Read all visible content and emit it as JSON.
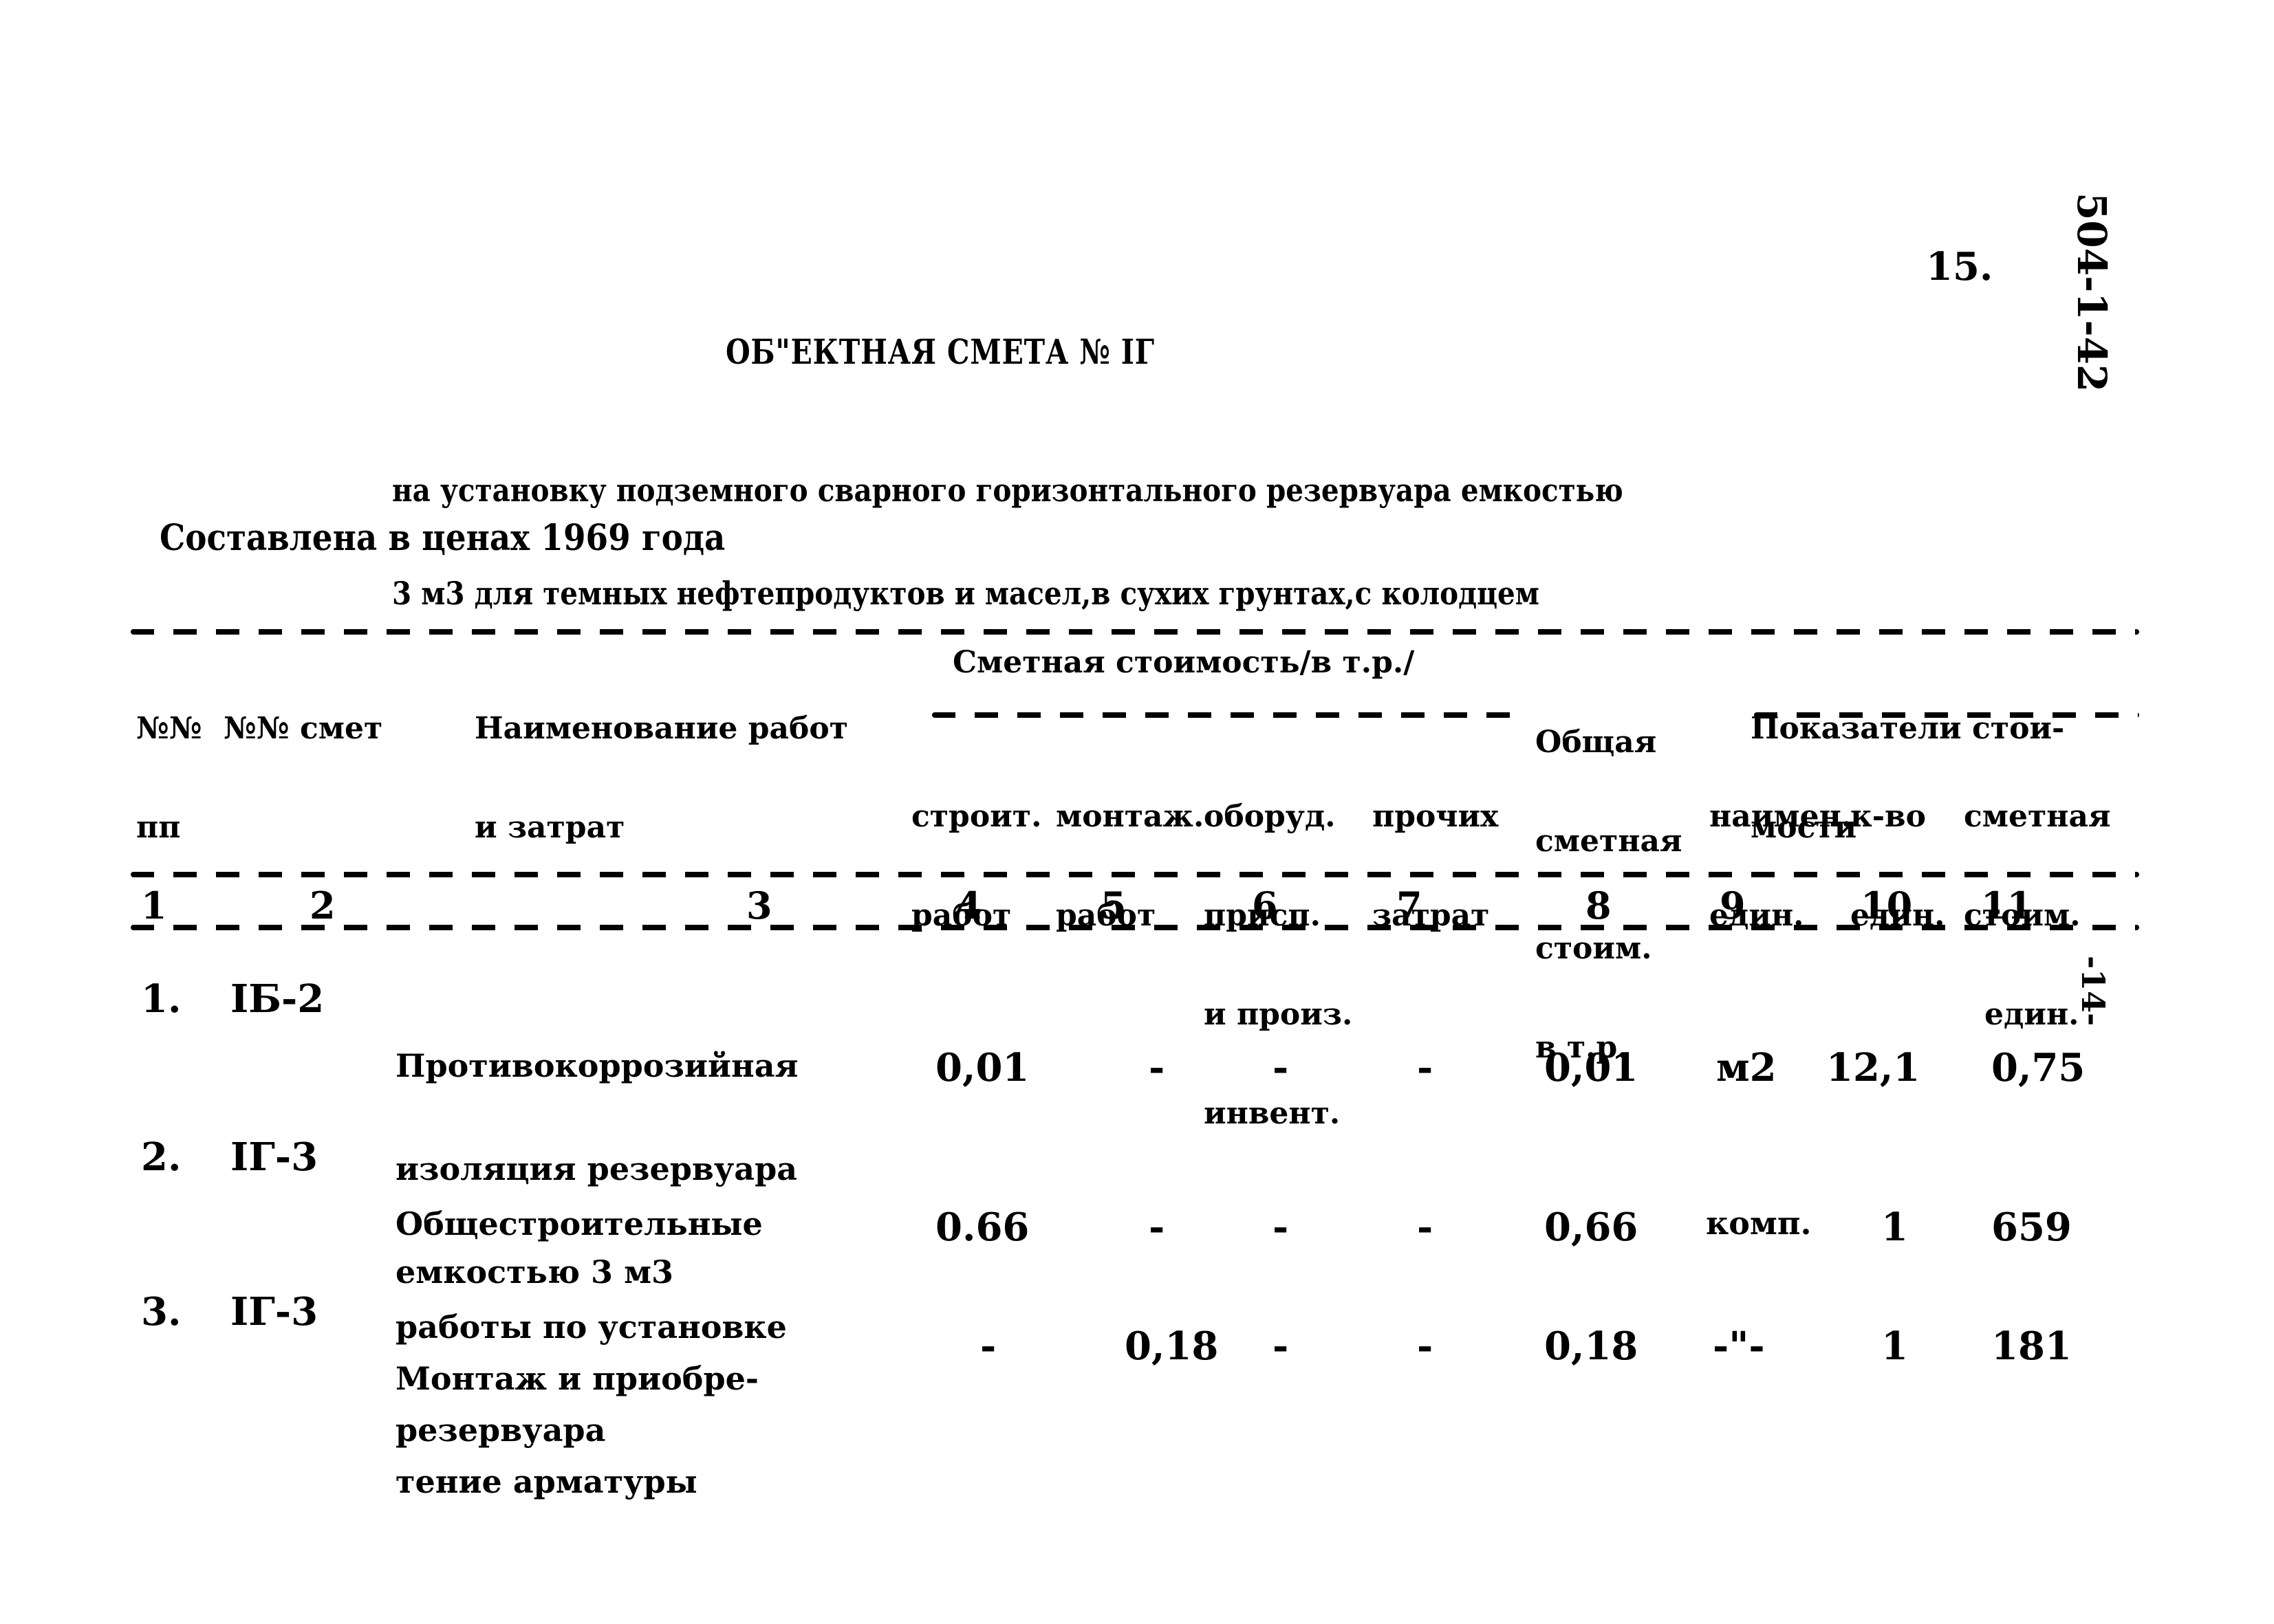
{
  "page_number": "15.",
  "document_code": "504-1-42",
  "side_mark": "-14-",
  "title": "ОБ\"ЕКТНАЯ СМЕТА № IГ",
  "subtitle_lines": [
    "на установку подземного сварного горизонтального резервуара емкостью",
    "3 м3 для темных нефтепродуктов и масел,в сухих грунтах,с колодцем"
  ],
  "prices_note": "Составлена в ценах 1969 года",
  "table": {
    "headers": {
      "col1": [
        "№№",
        "пп"
      ],
      "col2": [
        "№№ смет"
      ],
      "col3": [
        "Наименование работ",
        "и затрат"
      ],
      "estimated_cost_group": "Сметная стоимость/в т.р./",
      "col4": [
        "строит.",
        "работ"
      ],
      "col5": [
        "монтаж.",
        "работ"
      ],
      "col6": [
        "оборуд.",
        "присп.",
        "и произ.",
        "инвент."
      ],
      "col7": [
        "прочих",
        "затрат"
      ],
      "col8": [
        "Общая",
        "сметная",
        "стоим.",
        "в т.р."
      ],
      "indicators_group": [
        "Показатели стои-",
        "мости"
      ],
      "col9": [
        "наимен.",
        "един."
      ],
      "col10": [
        "к-во",
        "един."
      ],
      "col11": [
        "сметная",
        "стоим.",
        "един."
      ]
    },
    "column_numbers": [
      "1",
      "2",
      "3",
      "4",
      "5",
      "6",
      "7",
      "8",
      "9",
      "10",
      "11"
    ],
    "rows": [
      {
        "no": "1.",
        "estimate": "IБ-2",
        "name_lines": [
          "Противокоррозийная",
          "изоляция резервуара",
          "емкостью 3 м3"
        ],
        "construction": "0,01",
        "installation": "-",
        "equipment": "-",
        "other": "-",
        "total": "0,01",
        "unit": "м2",
        "quantity": "12,1",
        "unit_cost": "0,75"
      },
      {
        "no": "2.",
        "estimate": "IГ-3",
        "name_lines": [
          "Общестроительные",
          "работы по установке",
          "резервуара"
        ],
        "construction": "0.66",
        "installation": "-",
        "equipment": "-",
        "other": "-",
        "total": "0,66",
        "unit": "комп.",
        "quantity": "1",
        "unit_cost": "659"
      },
      {
        "no": "3.",
        "estimate": "IГ-3",
        "name_lines": [
          "Монтаж и приобре-",
          "тение арматуры"
        ],
        "construction": "-",
        "installation": "0,18",
        "equipment": "-",
        "other": "-",
        "total": "0,18",
        "unit": "-\"-",
        "quantity": "1",
        "unit_cost": "181"
      }
    ]
  }
}
